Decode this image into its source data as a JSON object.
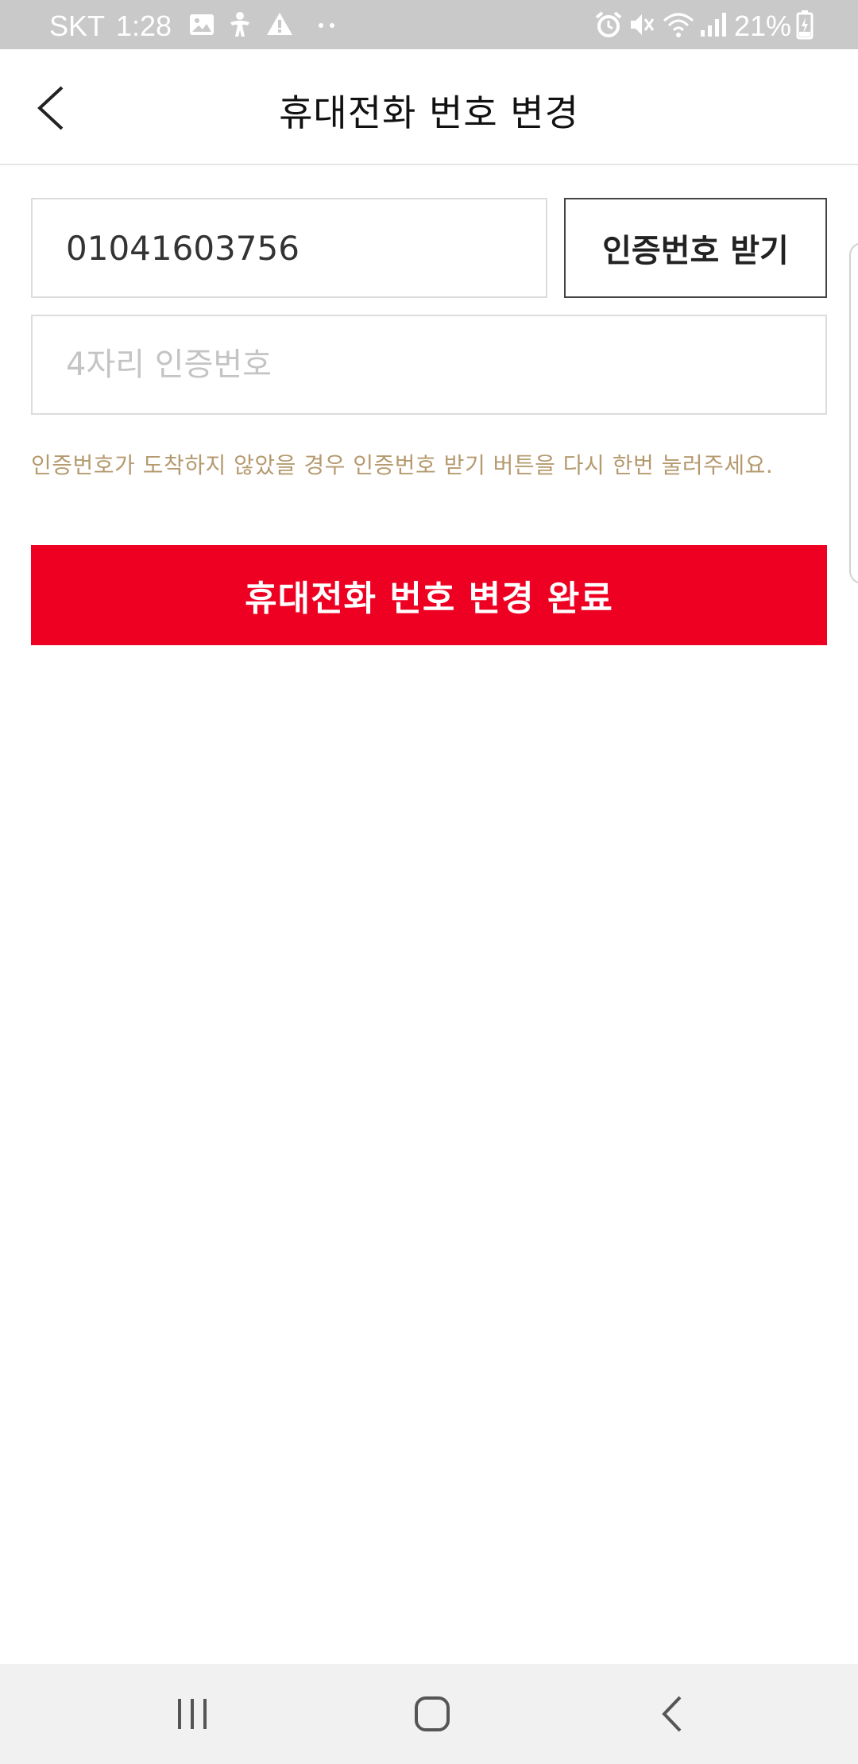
{
  "status_bar": {
    "carrier": "SKT",
    "time": "1:28",
    "battery": "21%"
  },
  "header": {
    "title": "휴대전화 번호 변경"
  },
  "form": {
    "phone_value": "01041603756",
    "get_code_label": "인증번호 받기",
    "code_placeholder": "4자리 인증번호",
    "help_text": "인증번호가 도착하지 않았을 경우 인증번호 받기 버튼을 다시 한번 눌러주세요.",
    "submit_label": "휴대전화 번호 변경 완료"
  },
  "colors": {
    "accent": "#ee0022",
    "help_text": "#b59a6f",
    "status_bar": "#c9c9c9",
    "nav_bar": "#f1f1f1"
  },
  "icons": {
    "header_back": "chevron-left-icon",
    "nav_recent": "recent-apps-icon",
    "nav_home": "home-icon",
    "nav_back": "back-icon"
  }
}
